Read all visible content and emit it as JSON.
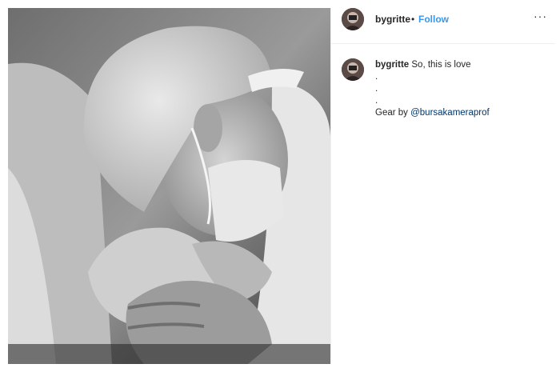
{
  "post": {
    "username": "bygritte",
    "separator": "•",
    "follow_label": "Follow",
    "more_icon": "···"
  },
  "caption": {
    "username": "bygritte",
    "text": "So, this is love",
    "dots": [
      ".",
      ".",
      "."
    ],
    "gear_prefix": "Gear by ",
    "mention": "@bursakameraprof"
  },
  "icons": {
    "more": "more-options-icon",
    "avatar": "profile-avatar"
  }
}
